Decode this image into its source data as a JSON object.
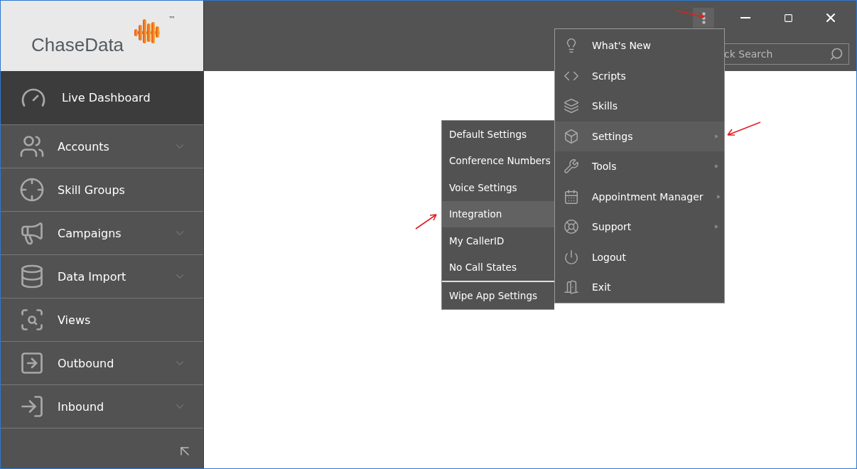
{
  "logo": {
    "text": "ChaseData",
    "trademark": "™"
  },
  "sidebar": {
    "items": [
      {
        "label": "Live Dashboard",
        "selected": true,
        "expandable": false
      },
      {
        "label": "Accounts",
        "selected": false,
        "expandable": true
      },
      {
        "label": "Skill Groups",
        "selected": false,
        "expandable": false
      },
      {
        "label": "Campaigns",
        "selected": false,
        "expandable": true
      },
      {
        "label": "Data Import",
        "selected": false,
        "expandable": true
      },
      {
        "label": "Views",
        "selected": false,
        "expandable": false
      },
      {
        "label": "Outbound",
        "selected": false,
        "expandable": true
      },
      {
        "label": "Inbound",
        "selected": false,
        "expandable": true
      }
    ]
  },
  "search": {
    "placeholder": "ck Search"
  },
  "menu": {
    "items": [
      {
        "label": "What's New",
        "highlighted": false,
        "submenu": false
      },
      {
        "label": "Scripts",
        "highlighted": false,
        "submenu": false
      },
      {
        "label": "Skills",
        "highlighted": false,
        "submenu": false
      },
      {
        "label": "Settings",
        "highlighted": true,
        "submenu": true
      },
      {
        "label": "Tools",
        "highlighted": false,
        "submenu": true
      },
      {
        "label": "Appointment Manager",
        "highlighted": false,
        "submenu": true
      },
      {
        "label": "Support",
        "highlighted": false,
        "submenu": true
      },
      {
        "label": "Logout",
        "highlighted": false,
        "submenu": false
      },
      {
        "label": "Exit",
        "highlighted": false,
        "submenu": false
      }
    ]
  },
  "submenu": {
    "items": [
      {
        "label": "Default Settings",
        "highlighted": false,
        "separator_before": false
      },
      {
        "label": "Conference Numbers",
        "highlighted": false,
        "separator_before": false
      },
      {
        "label": "Voice Settings",
        "highlighted": false,
        "separator_before": false
      },
      {
        "label": "Integration",
        "highlighted": true,
        "separator_before": false
      },
      {
        "label": "My CallerID",
        "highlighted": false,
        "separator_before": false
      },
      {
        "label": "No Call States",
        "highlighted": false,
        "separator_before": false
      },
      {
        "label": "Wipe App Settings",
        "highlighted": false,
        "separator_before": true
      }
    ]
  }
}
